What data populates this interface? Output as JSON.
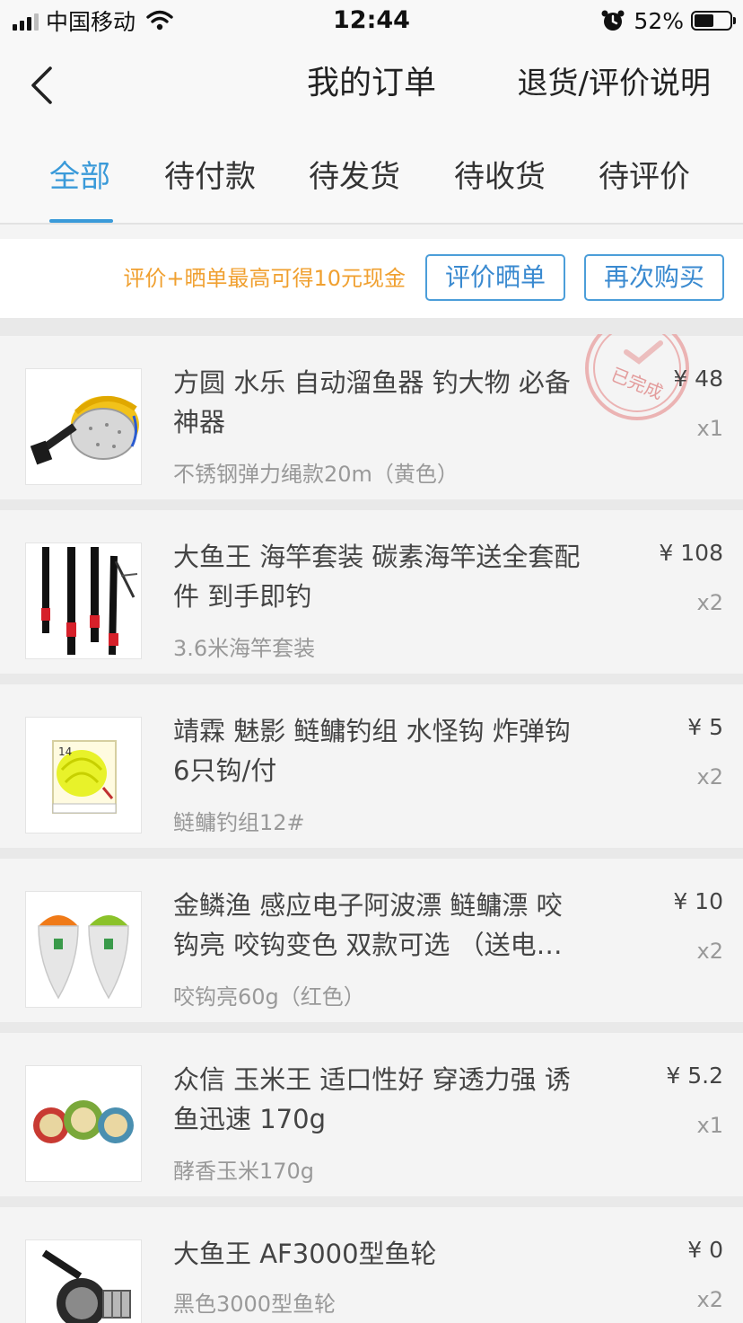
{
  "status_bar": {
    "carrier": "中国移动",
    "time": "12:44",
    "battery_percent": "52%",
    "battery_level": 0.52
  },
  "nav": {
    "title": "我的订单",
    "right_link": "退货/评价说明"
  },
  "tabs": [
    {
      "label": "全部",
      "active": true
    },
    {
      "label": "待付款",
      "active": false
    },
    {
      "label": "待发货",
      "active": false
    },
    {
      "label": "待收货",
      "active": false
    },
    {
      "label": "待评价",
      "active": false
    }
  ],
  "order": {
    "promo_text": "评价+晒单最高可得10元现金",
    "review_button": "评价晒单",
    "rebuy_button": "再次购买",
    "status_stamp": "已完成",
    "items": [
      {
        "title": "方圆 水乐 自动溜鱼器 钓大物 必备神器",
        "variant": "不锈钢弹力绳款20m（黄色）",
        "price": "¥ 48",
        "qty": "x1",
        "image": "fishing-reel-device-image"
      },
      {
        "title": "大鱼王 海竿套装 碳素海竿送全套配件 到手即钓",
        "variant": "3.6米海竿套装",
        "price": "¥ 108",
        "qty": "x2",
        "image": "fishing-rods-image"
      },
      {
        "title": "靖霖 魅影 鲢鳙钓组 水怪钩  炸弹钩 6只钩/付",
        "variant": "鲢鳙钓组12#",
        "price": "¥ 5",
        "qty": "x2",
        "image": "hook-set-box-image"
      },
      {
        "title": "金鳞渔 感应电子阿波漂 鲢鳙漂 咬钩亮 咬钩变色 双款可选 （送电…",
        "variant": "咬钩亮60g（红色）",
        "price": "¥ 10",
        "qty": "x2",
        "image": "electronic-floats-image"
      },
      {
        "title": "众信 玉米王 适口性好 穿透力强 诱鱼迅速 170g",
        "variant": "酵香玉米170g",
        "price": "¥ 5.2",
        "qty": "x1",
        "image": "corn-bait-cans-image"
      },
      {
        "title": "大鱼王 AF3000型鱼轮",
        "variant": "黑色3000型鱼轮",
        "price": "¥ 0",
        "qty": "x2",
        "image": "spinning-reel-image"
      }
    ]
  }
}
